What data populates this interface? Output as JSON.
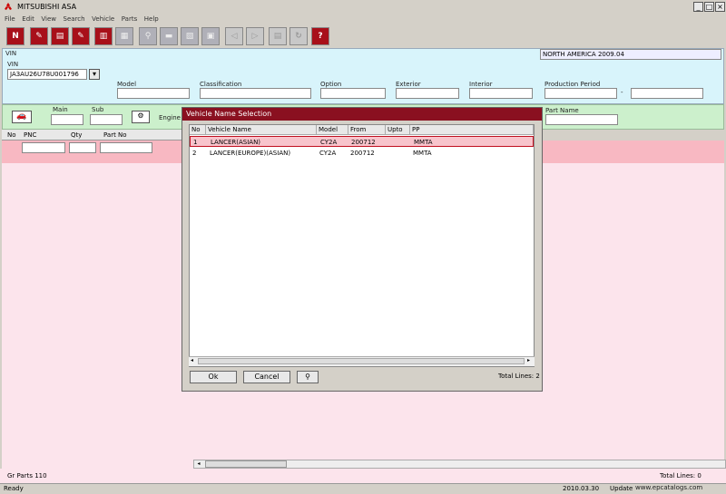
{
  "window": {
    "title": "MITSUBISHI ASA",
    "controls": [
      "_",
      "□",
      "×"
    ]
  },
  "menu": [
    "File",
    "Edit",
    "View",
    "Search",
    "Vehicle",
    "Parts",
    "Help"
  ],
  "toolbar": {
    "help_label": "?"
  },
  "vin_panel": {
    "vin_label": "VIN",
    "region": "NORTH AMERICA 2009.04",
    "vin_label2": "VIN",
    "vin_value": "JA3AU26U78U001796",
    "model_label": "Model",
    "classification_label": "Classification",
    "option_label": "Option",
    "exterior_label": "Exterior",
    "interior_label": "Interior",
    "production_period_label": "Production Period",
    "dash": "-"
  },
  "green_panel": {
    "main_label": "Main",
    "sub_label": "Sub",
    "engine_label": "Engine",
    "part_name_label": "Part Name"
  },
  "grid_header": [
    "No",
    "PNC",
    "Qty",
    "Part No"
  ],
  "dialog": {
    "title": "Vehicle Name Selection",
    "columns": [
      "No",
      "Vehicle Name",
      "Model",
      "From",
      "Upto",
      "PP"
    ],
    "rows": [
      {
        "no": "1",
        "name": "LANCER(ASIAN)",
        "model": "CY2A",
        "from": "200712",
        "upto": "",
        "pp": "MMTA"
      },
      {
        "no": "2",
        "name": "LANCER(EUROPE)(ASIAN)",
        "model": "CY2A",
        "from": "200712",
        "upto": "",
        "pp": "MMTA"
      }
    ],
    "ok_label": "Ok",
    "cancel_label": "Cancel",
    "total_lines": "Total Lines: 2"
  },
  "status_row": {
    "left": "Gr Parts 110",
    "right": "Total Lines: 0"
  },
  "status_bar": {
    "ready": "Ready",
    "date": "2010.03.30",
    "update": "Update",
    "watermark": "www.epcatalogs.com"
  }
}
